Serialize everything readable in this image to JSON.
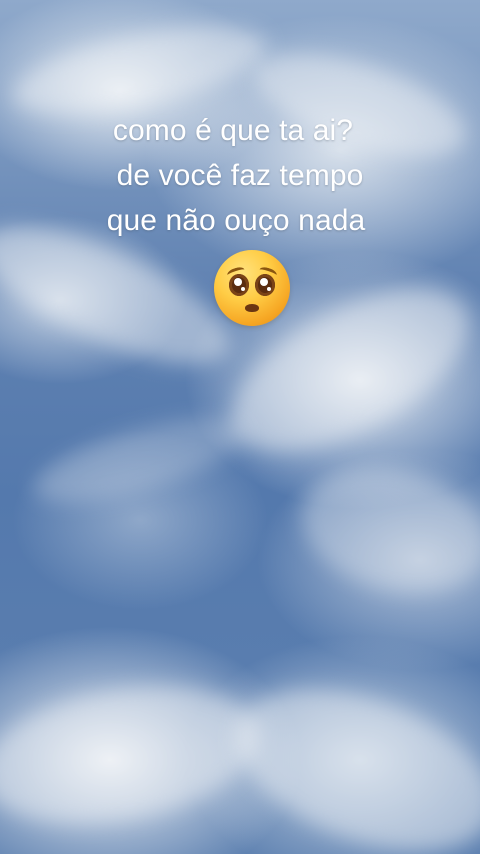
{
  "caption": {
    "lines": [
      "como é que ta ai?",
      "de você faz tempo",
      "que não ouço nada"
    ]
  },
  "emoji": {
    "name": "pleading-face-icon"
  },
  "colors": {
    "sky_top": "#8fa9cb",
    "sky_mid": "#5479ad",
    "cloud": "#eef2f6",
    "text": "#ffffff"
  }
}
